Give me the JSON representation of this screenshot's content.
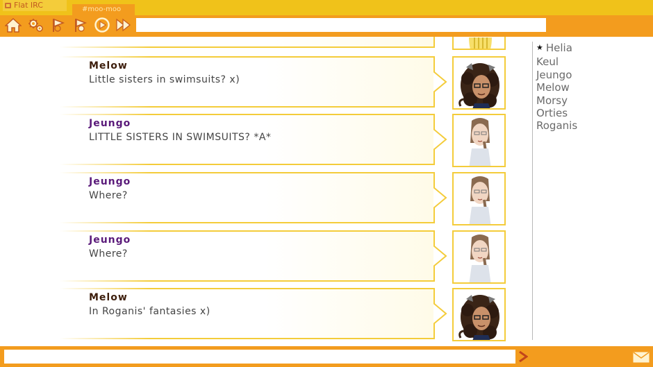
{
  "tabs": {
    "server": "Flat IRC",
    "channel": "#moo-moo"
  },
  "toolbar": {
    "icons": [
      "home-icon",
      "gears-icon",
      "flag-icon",
      "flag-alt-icon",
      "play-icon",
      "fast-forward-icon"
    ],
    "topic_value": ""
  },
  "messages": [
    {
      "nick": "Melow",
      "text": "Little sisters in swimsuits? x)",
      "nick_color": "#3d1e0c"
    },
    {
      "nick": "Jeungo",
      "text": "LITTLE SISTERS IN SWIMSUITS? *A*",
      "nick_color": "#5a1a7a"
    },
    {
      "nick": "Jeungo",
      "text": "Where?",
      "nick_color": "#5a1a7a"
    },
    {
      "nick": "Jeungo",
      "text": "Where?",
      "nick_color": "#5a1a7a"
    },
    {
      "nick": "Melow",
      "text": "In Roganis' fantasies x)",
      "nick_color": "#3d1e0c"
    }
  ],
  "users": [
    {
      "name": "Helia",
      "op": true
    },
    {
      "name": "Keul",
      "op": false
    },
    {
      "name": "Jeungo",
      "op": false
    },
    {
      "name": "Melow",
      "op": false
    },
    {
      "name": "Morsy",
      "op": false
    },
    {
      "name": "Orties",
      "op": false
    },
    {
      "name": "Roganis",
      "op": false
    }
  ],
  "op_marker": "★",
  "composer": {
    "value": "",
    "send_icon": "send-arrow-icon",
    "mail_icon": "mail-icon"
  },
  "colors": {
    "accent": "#f39c1e",
    "accent_light": "#f0c21a",
    "bubble_border": "#f4cc3a",
    "melow": "#3d1e0c",
    "jeungo": "#5a1a7a"
  }
}
